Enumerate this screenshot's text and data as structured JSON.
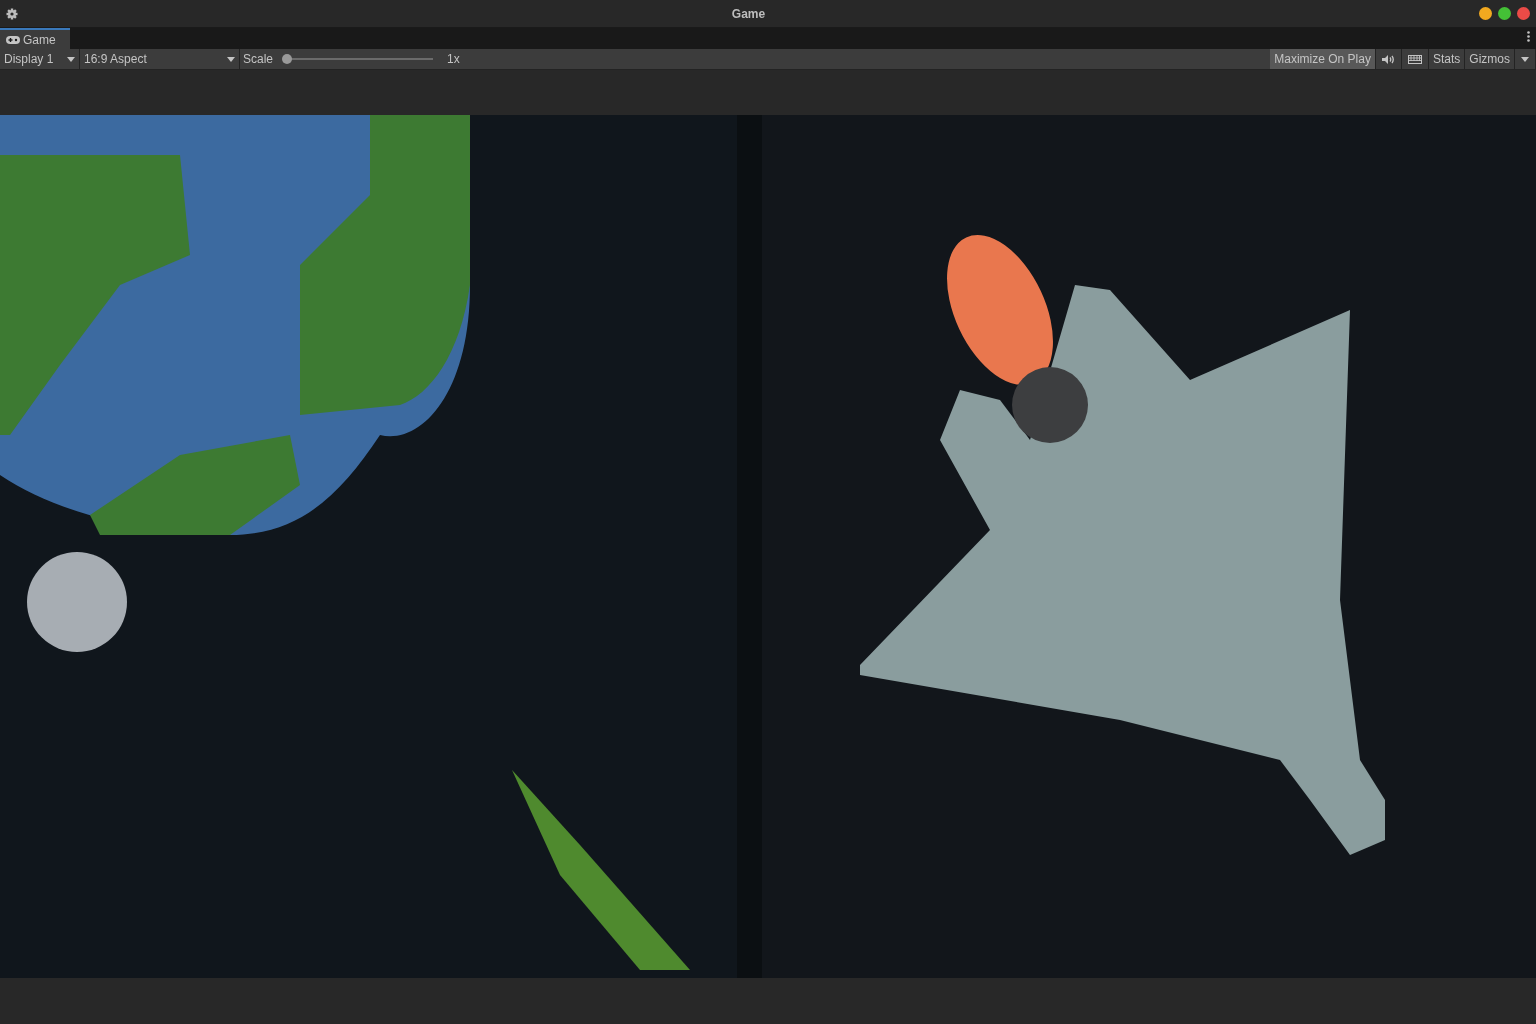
{
  "window": {
    "title": "Game"
  },
  "tabs": [
    {
      "label": "Game",
      "selected": true
    }
  ],
  "toolbar": {
    "display": "Display 1",
    "aspect": "16:9 Aspect",
    "scale_label": "Scale",
    "scale": {
      "level": 0
    },
    "scale_reading": "1x",
    "maximize_on_play": {
      "label": "Maximize On Play",
      "on": true
    },
    "mute_audio": {
      "on": false
    },
    "stats": {
      "label": "Stats",
      "on": false
    },
    "gizmos": {
      "label": "Gizmos",
      "on": false
    }
  }
}
